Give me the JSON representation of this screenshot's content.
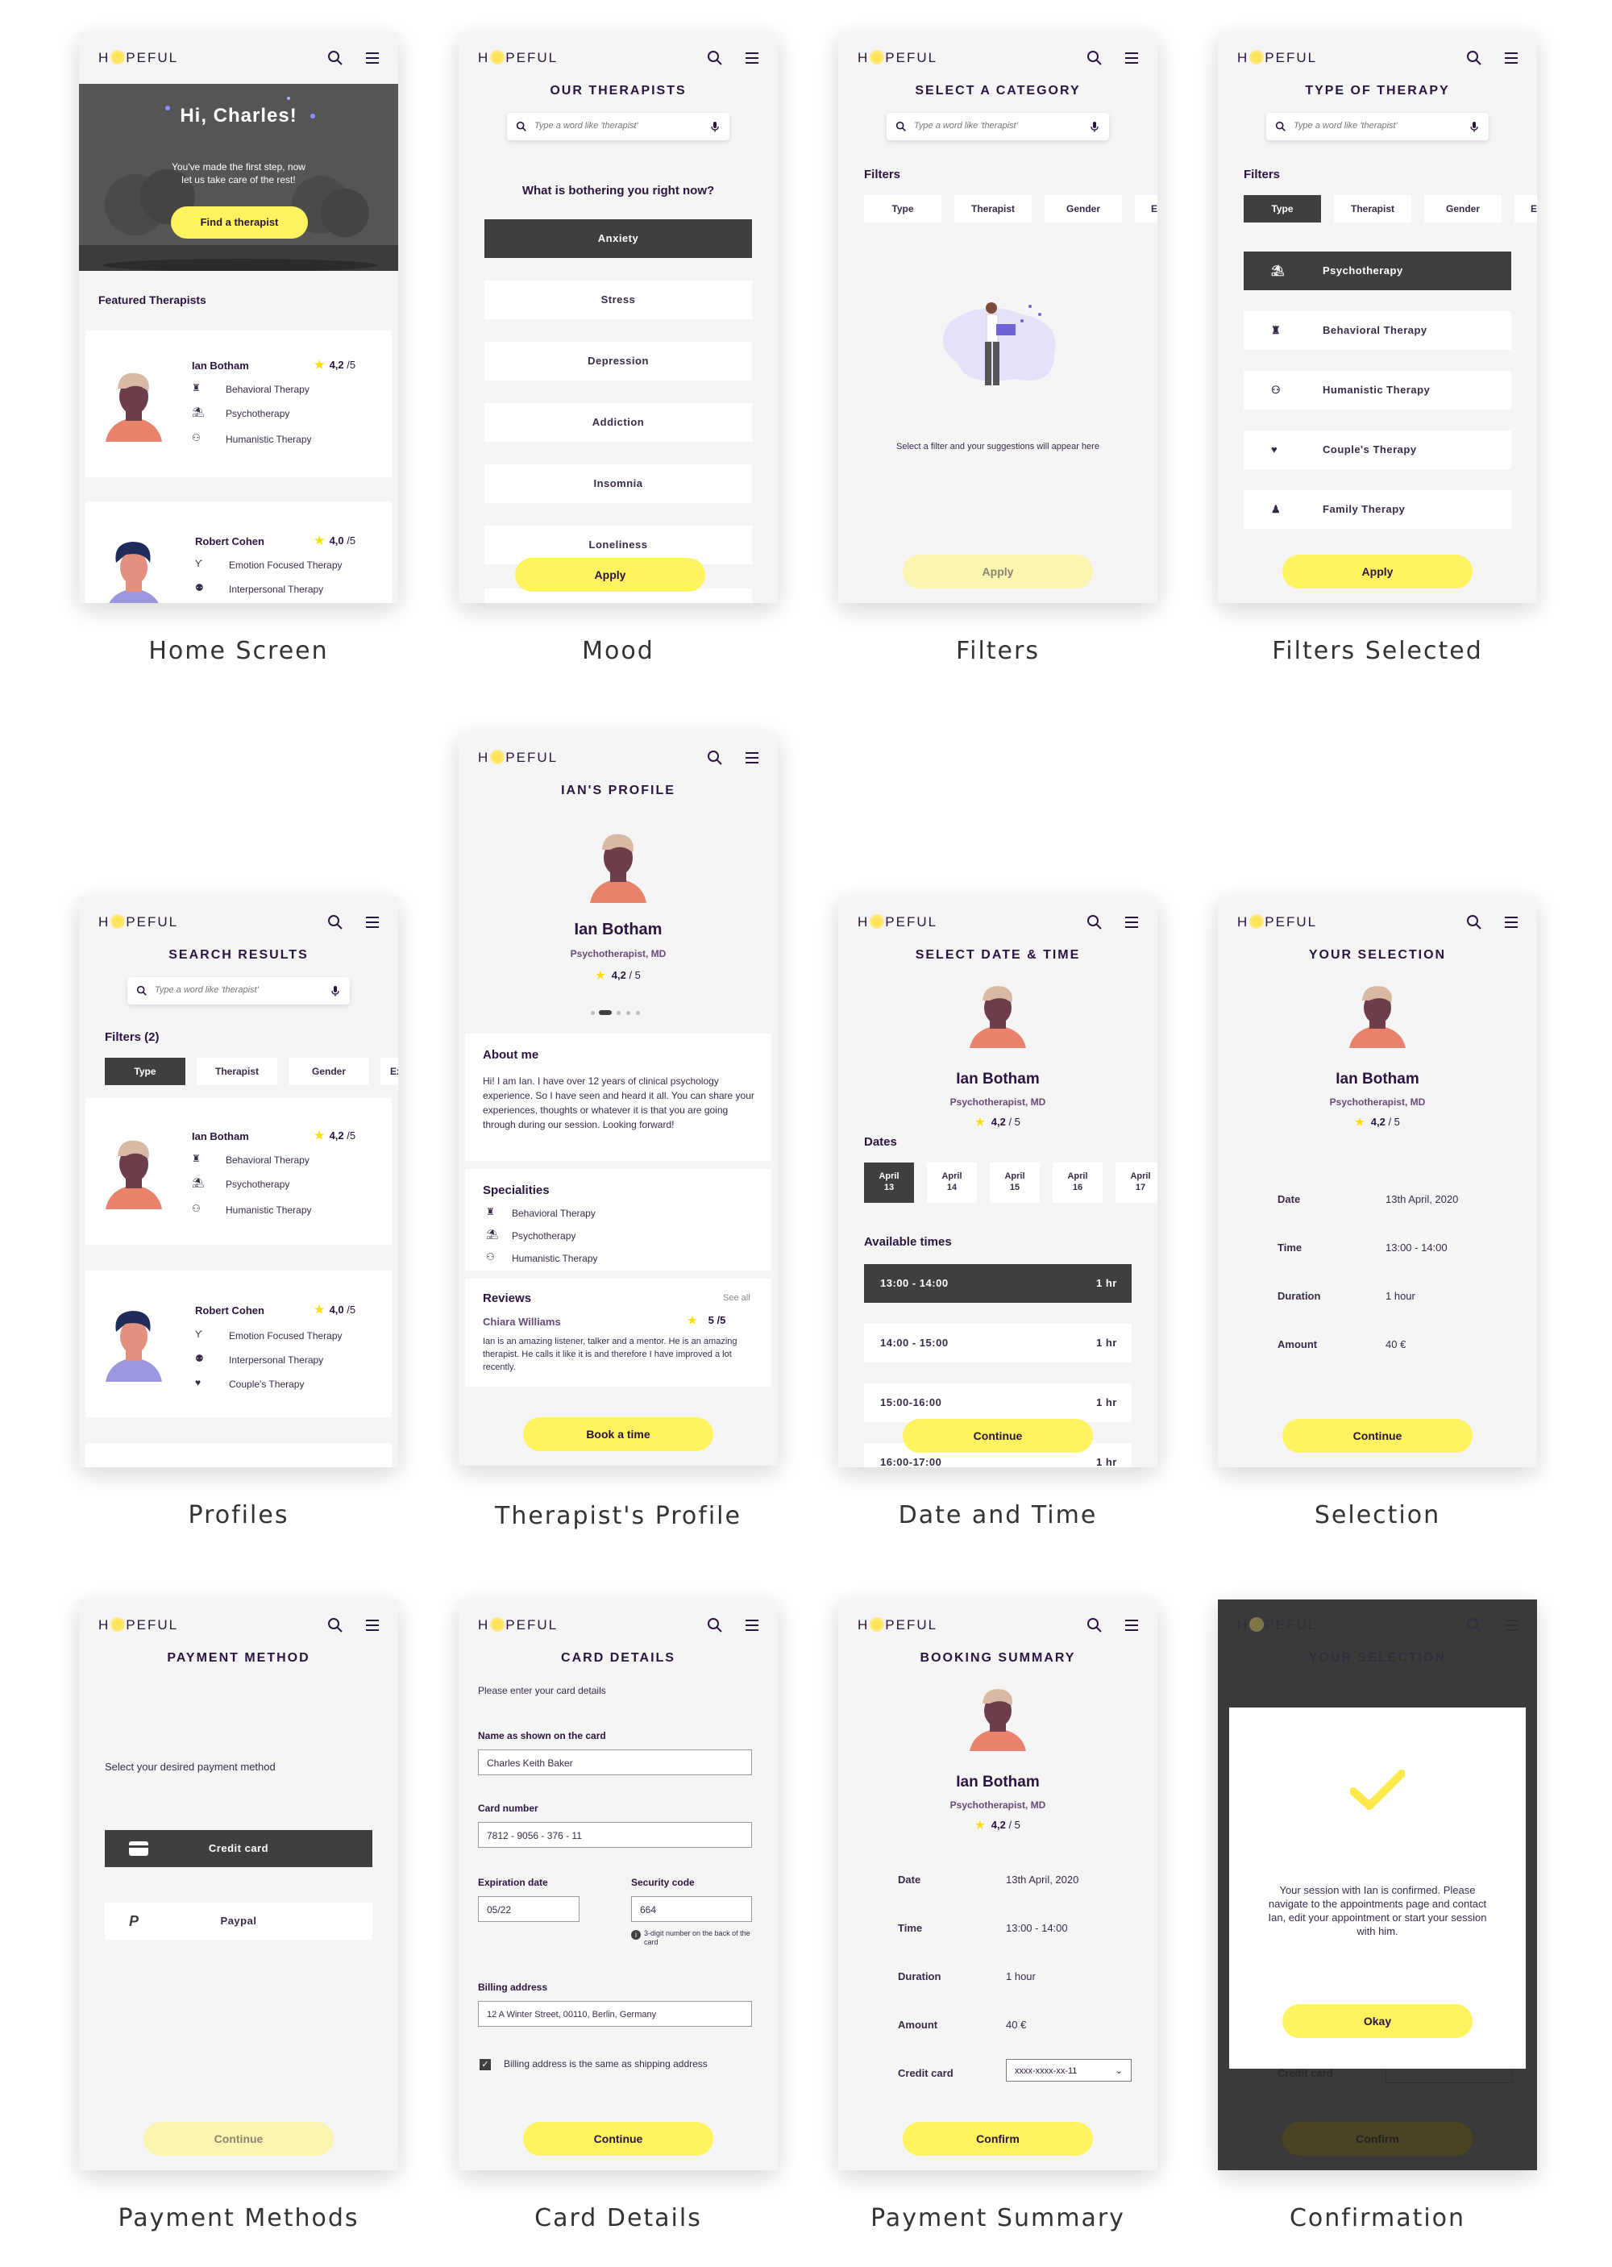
{
  "brand": {
    "pre": "H",
    "post": "PEFUL"
  },
  "captions": [
    "Home Screen",
    "Mood",
    "Filters",
    "Filters Selected",
    "Therapist's Profile",
    "Profiles",
    "Date and Time",
    "Selection",
    "Payment Methods",
    "Card Details",
    "Payment Summary",
    "Confirmation"
  ],
  "colors": {
    "accent": "#fff35f",
    "dark": "#3f3f3f",
    "text": "#2b1540",
    "bg": "#f5f5f5"
  },
  "search_placeholder": "Type a word like 'therapist'",
  "home": {
    "greeting": "Hi, Charles!",
    "subtitle_1": "You've made the first step, now",
    "subtitle_2": "let us take care of the rest!",
    "cta": "Find a therapist",
    "featured": "Featured Therapists"
  },
  "therapists": [
    {
      "name": "Ian Botham",
      "rating": "4,2",
      "max": "/5",
      "specialties": [
        "Behavioral Therapy",
        "Psychotherapy",
        "Humanistic Therapy"
      ]
    },
    {
      "name": "Robert Cohen",
      "rating": "4,0",
      "max": "/5",
      "specialties": [
        "Emotion Focused Therapy",
        "Interpersonal Therapy",
        "Couple's Therapy"
      ]
    }
  ],
  "mood": {
    "title": "OUR THERAPISTS",
    "question": "What is bothering you right now?",
    "options": [
      "Anxiety",
      "Stress",
      "Depression",
      "Addiction",
      "Insomnia",
      "Loneliness"
    ],
    "apply": "Apply"
  },
  "filters": {
    "title": "SELECT A CATEGORY",
    "label": "Filters",
    "chips": [
      "Type",
      "Therapist",
      "Gender",
      "Ex"
    ],
    "empty": "Select a filter and your suggestions will appear here",
    "apply": "Apply"
  },
  "filters_selected": {
    "title": "TYPE OF THERAPY",
    "label": "Filters",
    "chips": [
      "Type",
      "Therapist",
      "Gender",
      "Ex"
    ],
    "options": [
      "Psychotherapy",
      "Behavioral Therapy",
      "Humanistic Therapy",
      "Couple's Therapy",
      "Family Therapy"
    ],
    "apply": "Apply"
  },
  "profile": {
    "title": "IAN'S PROFILE",
    "name": "Ian Botham",
    "role": "Psychotherapist, MD",
    "rating": "4,2",
    "max": "/ 5",
    "about_h": "About me",
    "about": "Hi! I am Ian. I have over 12 years of clinical psychology experience. So I have seen and heard it all. You can share your experiences, thoughts or whatever it is that you are going through during our session. Looking forward!",
    "spec_h": "Specialities",
    "specs": [
      "Behavioral Therapy",
      "Psychotherapy",
      "Humanistic Therapy"
    ],
    "reviews_h": "Reviews",
    "see_all": "See all",
    "reviewer": "Chiara Williams",
    "review_rating": "5 /5",
    "review": "Ian is an amazing listener, talker and a mentor. He is an amazing therapist. He calls it like it is and therefore I have improved a lot recently.",
    "cta": "Book a time"
  },
  "results": {
    "title": "SEARCH RESULTS",
    "label": "Filters (2)",
    "chips": [
      "Type",
      "Therapist",
      "Gender",
      "Ex"
    ]
  },
  "datetime": {
    "title": "SELECT DATE & TIME",
    "dates_h": "Dates",
    "dates": [
      {
        "m": "April",
        "d": "13"
      },
      {
        "m": "April",
        "d": "14"
      },
      {
        "m": "April",
        "d": "15"
      },
      {
        "m": "April",
        "d": "16"
      },
      {
        "m": "April",
        "d": "17"
      }
    ],
    "times_h": "Available times",
    "times": [
      "13:00 - 14:00",
      "14:00 - 15:00",
      "15:00-16:00",
      "16:00-17:00"
    ],
    "dur": "1 hr",
    "cta": "Continue"
  },
  "selection": {
    "title": "YOUR SELECTION",
    "rows": [
      {
        "k": "Date",
        "v": "13th April, 2020"
      },
      {
        "k": "Time",
        "v": "13:00 - 14:00"
      },
      {
        "k": "Duration",
        "v": "1 hour"
      },
      {
        "k": "Amount",
        "v": "40 €"
      }
    ],
    "cta": "Continue"
  },
  "payment": {
    "title": "PAYMENT METHOD",
    "prompt": "Select your desired payment method",
    "credit": "Credit card",
    "paypal": "Paypal",
    "cta": "Continue"
  },
  "card": {
    "title": "CARD DETAILS",
    "prompt": "Please enter your card details",
    "name_l": "Name as shown on the card",
    "name_v": "Charles Keith Baker",
    "num_l": "Card number",
    "num_v": "7812 - 9056 - 376 - 11",
    "exp_l": "Expiration date",
    "exp_v": "05/22",
    "sec_l": "Security code",
    "sec_v": "664",
    "sec_hint": "3-digit number on the back of the card",
    "bill_l": "Billing address",
    "bill_v": "12 A Winter Street, 00110, Berlin, Germany",
    "same": "Billing address is the same as shipping address",
    "cta": "Continue"
  },
  "summary": {
    "title": "BOOKING SUMMARY",
    "rows": [
      {
        "k": "Date",
        "v": "13th April, 2020"
      },
      {
        "k": "Time",
        "v": "13:00 - 14:00"
      },
      {
        "k": "Duration",
        "v": "1 hour"
      },
      {
        "k": "Amount",
        "v": "40 €"
      }
    ],
    "cc_k": "Credit card",
    "cc_v": "xxxx-xxxx-xx-11",
    "cta": "Confirm"
  },
  "confirm": {
    "title": "YOUR SELECTION",
    "message": "Your session with Ian is confirmed. Please navigate to the appointments page and contact Ian, edit your appointment or start your session with him.",
    "ok": "Okay",
    "behind_cc": "Credit card",
    "behind_cta": "Confirm"
  }
}
